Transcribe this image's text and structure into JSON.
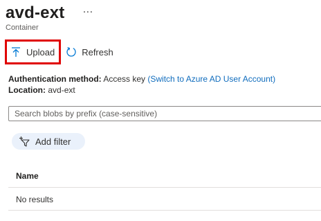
{
  "header": {
    "title": "avd-ext",
    "more_label": "···",
    "subtitle": "Container"
  },
  "toolbar": {
    "upload_label": "Upload",
    "upload_icon": "upload-icon",
    "refresh_label": "Refresh",
    "refresh_icon": "refresh-icon",
    "highlight_color": "#e00000"
  },
  "info": {
    "auth_label": "Authentication method:",
    "auth_value": "Access key",
    "auth_link": "(Switch to Azure AD User Account)",
    "location_label": "Location:",
    "location_value": "avd-ext"
  },
  "search": {
    "placeholder": "Search blobs by prefix (case-sensitive)",
    "value": ""
  },
  "filter": {
    "label": "Add filter",
    "icon": "add-filter-icon"
  },
  "table": {
    "columns": [
      "Name"
    ],
    "rows": [],
    "empty_text": "No results"
  },
  "colors": {
    "link": "#0f6cbd",
    "accent": "#0078d4",
    "pill_bg": "#eaf1fb"
  }
}
